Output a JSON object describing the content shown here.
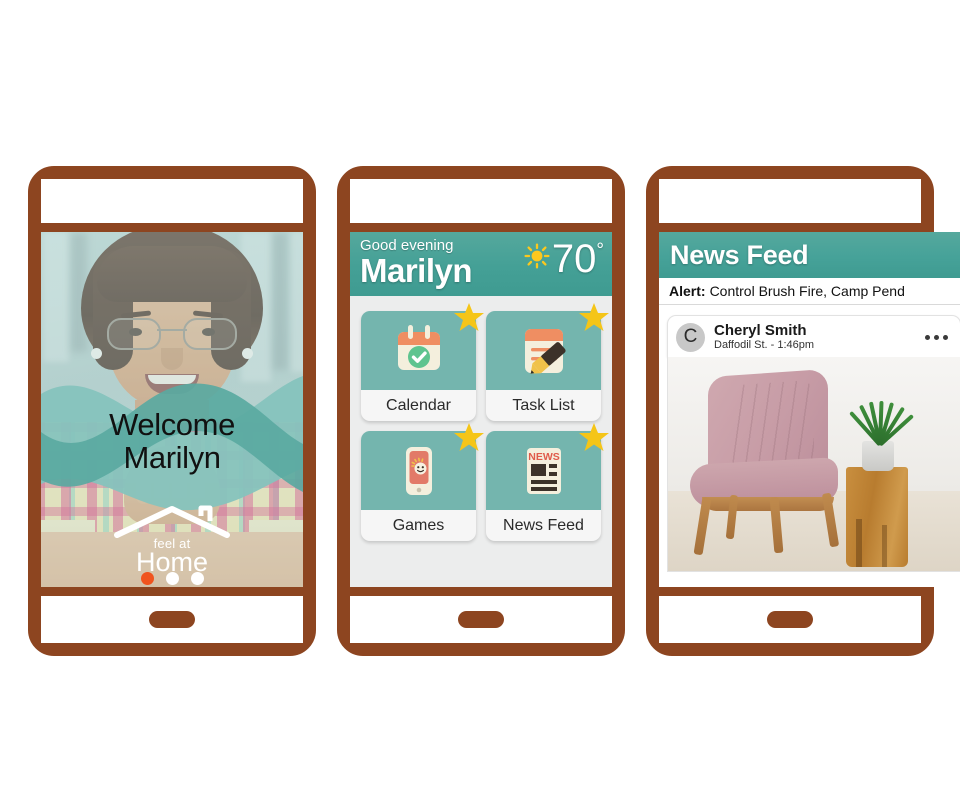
{
  "brand": {
    "frame_color": "#8d4520",
    "teal": "#46a299",
    "accent_orange": "#f0541e",
    "tile_teal": "#74b5ae",
    "star_yellow": "#f5c518"
  },
  "phone_welcome": {
    "name": "welcome-screen",
    "welcome_line1": "Welcome",
    "welcome_line2": "Marilyn",
    "logo_top": "feel at",
    "logo_bottom": "Home",
    "dots": [
      {
        "label": "slide-1",
        "active": true
      },
      {
        "label": "slide-2",
        "active": false
      },
      {
        "label": "slide-3",
        "active": false
      }
    ]
  },
  "phone_home": {
    "name": "home-screen",
    "greeting": "Good evening",
    "user_name": "Marilyn",
    "weather_icon": "sun-icon",
    "temperature": "70",
    "degree_symbol": "°",
    "tiles": [
      {
        "label": "Calendar",
        "icon": "calendar-icon",
        "starred": true
      },
      {
        "label": "Task List",
        "icon": "notepad-pencil-icon",
        "starred": true
      },
      {
        "label": "Games",
        "icon": "game-phone-icon",
        "starred": true
      },
      {
        "label": "News Feed",
        "icon": "newspaper-icon",
        "starred": true
      }
    ]
  },
  "phone_news": {
    "name": "news-feed-screen",
    "title": "News Feed",
    "alert_label": "Alert:",
    "alert_text": "Control Brush Fire, Camp Pend",
    "post": {
      "avatar_initial": "C",
      "author": "Cheryl Smith",
      "meta": "Daffodil St. - 1:46pm",
      "more_icon": "more-options-icon",
      "image_alt": "pink-armchair-photo"
    }
  }
}
